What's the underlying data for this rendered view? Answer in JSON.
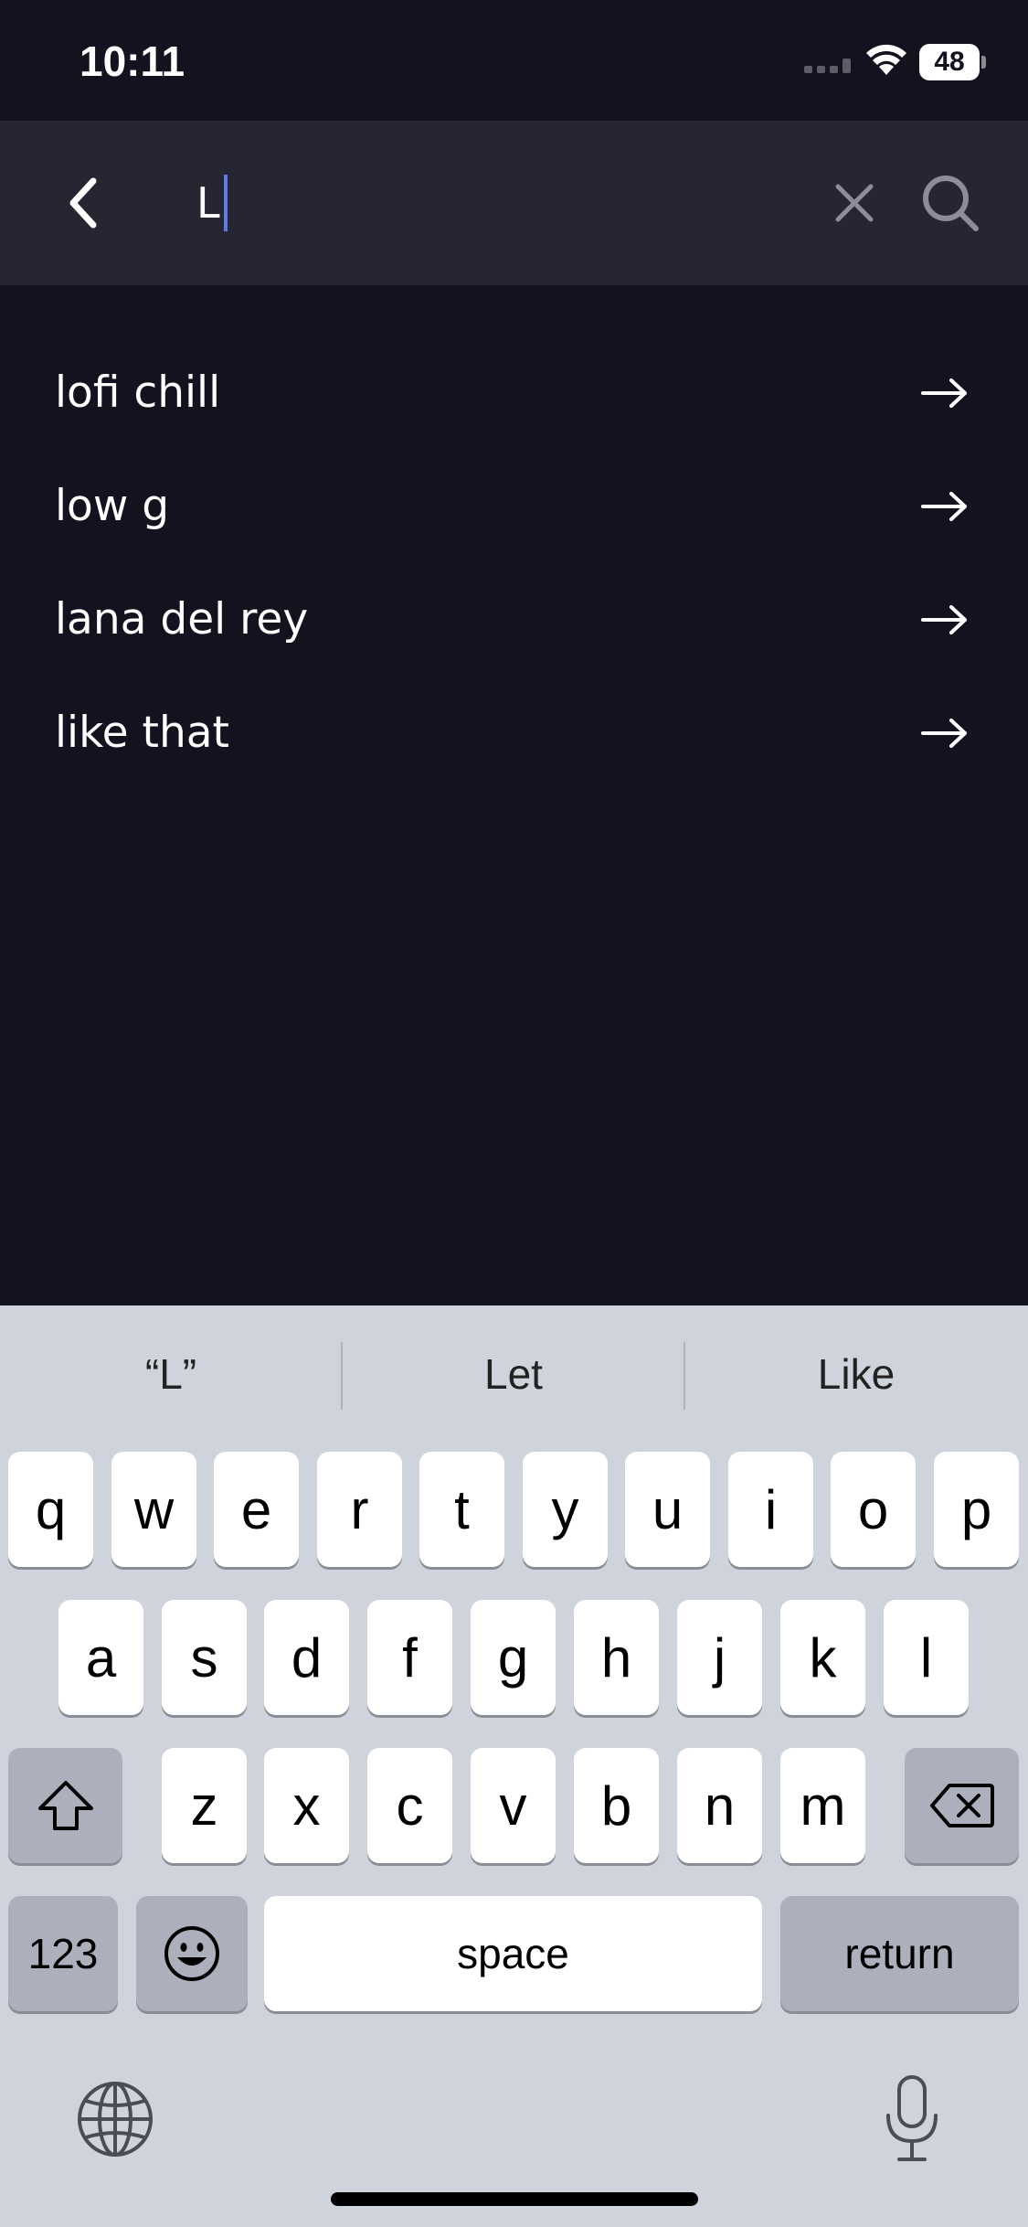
{
  "status_bar": {
    "time": "10:11",
    "battery_level": "48"
  },
  "search": {
    "query": "L",
    "icons": {
      "back": "chevron-left-icon",
      "clear": "close-icon",
      "search": "search-icon"
    }
  },
  "suggestions": [
    {
      "label": "lofi chill"
    },
    {
      "label": "low g"
    },
    {
      "label": "lana del rey"
    },
    {
      "label": "like that"
    }
  ],
  "keyboard": {
    "predictions": [
      "“L”",
      "Let",
      "Like"
    ],
    "row1": [
      "q",
      "w",
      "e",
      "r",
      "t",
      "y",
      "u",
      "i",
      "o",
      "p"
    ],
    "row2": [
      "a",
      "s",
      "d",
      "f",
      "g",
      "h",
      "j",
      "k",
      "l"
    ],
    "row3": [
      "z",
      "x",
      "c",
      "v",
      "b",
      "n",
      "m"
    ],
    "numbers_label": "123",
    "space_label": "space",
    "return_label": "return",
    "icons": {
      "shift": "shift-icon",
      "delete": "backspace-icon",
      "emoji": "emoji-icon",
      "globe": "globe-icon",
      "mic": "microphone-icon"
    }
  },
  "colors": {
    "background": "#13131f",
    "header": "#262633",
    "caret": "#5a7de6",
    "keyboard": "#cfd3dc"
  }
}
